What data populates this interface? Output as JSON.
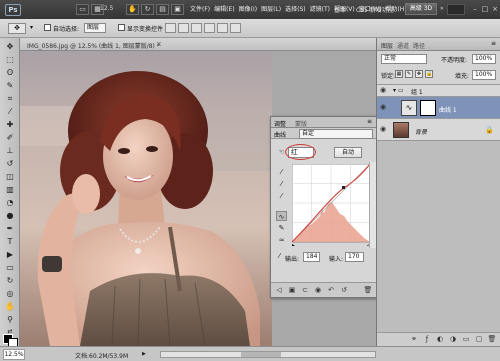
{
  "menubar": {
    "app_logo": "Ps",
    "zoom": "12.5",
    "items": [
      "文件(F)",
      "编辑(E)",
      "图像(I)",
      "图层(L)",
      "选择(S)",
      "滤镜(T)",
      "视图(V)",
      "窗口(W)",
      "帮助(H)"
    ],
    "workspace_basic": "基本",
    "workspace_cs5": "CS5 新增功能",
    "workspace_3d": "高级 3D",
    "workspace_arrow": "»"
  },
  "options": {
    "auto_select_label": "自动选择:",
    "auto_select_value": "图层",
    "transform_label": "显示变换控件"
  },
  "document": {
    "tab_title": "IMG_0586.jpg @ 12.5% (曲线 1, 图层蒙版/8) *",
    "close": "×"
  },
  "status": {
    "zoom": "12.5%",
    "doc_info": "文档:60.2M/53.9M"
  },
  "dock": {
    "tabs": [
      "图层",
      "通道",
      "路径"
    ],
    "blend_mode": "正常",
    "opacity_label": "不透明度:",
    "opacity_value": "100%",
    "lock_label": "锁定:",
    "fill_label": "填充:",
    "fill_value": "100%",
    "layers": [
      {
        "name": "组 1"
      },
      {
        "name": "曲线 1"
      },
      {
        "name": "背景"
      }
    ]
  },
  "adjustments": {
    "tabs": [
      "调整",
      "蒙版"
    ],
    "subhead": "曲线",
    "preset": "自定",
    "channel": "红",
    "auto_button": "自动",
    "output_label": "输出:",
    "output_value": "184",
    "input_label": "输入:",
    "input_value": "170"
  },
  "colors": {
    "accent_circle": "#d23a3a",
    "selected_layer": "#7f93b9",
    "curve_line": "#d0443c",
    "histogram": "#e8a08e"
  }
}
